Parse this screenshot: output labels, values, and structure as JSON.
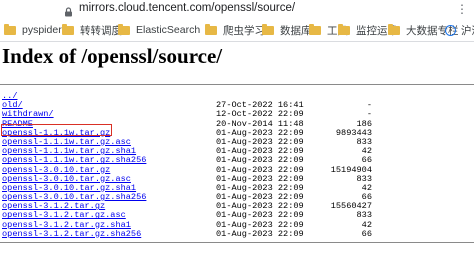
{
  "browser": {
    "url": "mirrors.cloud.tencent.com/openssl/source/",
    "bookmarks": [
      {
        "label": "pyspider",
        "icon": "folder-icon"
      },
      {
        "label": "转转调度",
        "icon": "folder-icon"
      },
      {
        "label": "ElasticSearch",
        "icon": "folder-icon"
      },
      {
        "label": "爬虫学习",
        "icon": "folder-icon"
      },
      {
        "label": "数据库",
        "icon": "folder-icon"
      },
      {
        "label": "工具",
        "icon": "folder-icon"
      },
      {
        "label": "监控运维",
        "icon": "folder-icon"
      },
      {
        "label": "大数据专栏",
        "icon": "folder-icon"
      },
      {
        "label": "沪深媒",
        "icon": "globe-icon"
      }
    ]
  },
  "page": {
    "title": "Index of /openssl/source/",
    "parent_link": "../",
    "rows": [
      {
        "name": "old/",
        "date": "27-Oct-2022 16:41",
        "size": "-"
      },
      {
        "name": "withdrawn/",
        "date": "12-Oct-2022 22:09",
        "size": "-"
      },
      {
        "name": "README",
        "date": "20-Nov-2014 11:48",
        "size": "186"
      },
      {
        "name": "openssl-1.1.1w.tar.gz",
        "date": "01-Aug-2023 22:09",
        "size": "9893443"
      },
      {
        "name": "openssl-1.1.1w.tar.gz.asc",
        "date": "01-Aug-2023 22:09",
        "size": "833"
      },
      {
        "name": "openssl-1.1.1w.tar.gz.sha1",
        "date": "01-Aug-2023 22:09",
        "size": "42"
      },
      {
        "name": "openssl-1.1.1w.tar.gz.sha256",
        "date": "01-Aug-2023 22:09",
        "size": "66"
      },
      {
        "name": "openssl-3.0.10.tar.gz",
        "date": "01-Aug-2023 22:09",
        "size": "15194904"
      },
      {
        "name": "openssl-3.0.10.tar.gz.asc",
        "date": "01-Aug-2023 22:09",
        "size": "833"
      },
      {
        "name": "openssl-3.0.10.tar.gz.sha1",
        "date": "01-Aug-2023 22:09",
        "size": "42"
      },
      {
        "name": "openssl-3.0.10.tar.gz.sha256",
        "date": "01-Aug-2023 22:09",
        "size": "66"
      },
      {
        "name": "openssl-3.1.2.tar.gz",
        "date": "01-Aug-2023 22:09",
        "size": "15560427"
      },
      {
        "name": "openssl-3.1.2.tar.gz.asc",
        "date": "01-Aug-2023 22:09",
        "size": "833"
      },
      {
        "name": "openssl-3.1.2.tar.gz.sha1",
        "date": "01-Aug-2023 22:09",
        "size": "42"
      },
      {
        "name": "openssl-3.1.2.tar.gz.sha256",
        "date": "01-Aug-2023 22:09",
        "size": "66"
      }
    ]
  },
  "colors": {
    "link": "#0000ee",
    "highlight_box": "#d93025",
    "folder": "#e7b845"
  }
}
